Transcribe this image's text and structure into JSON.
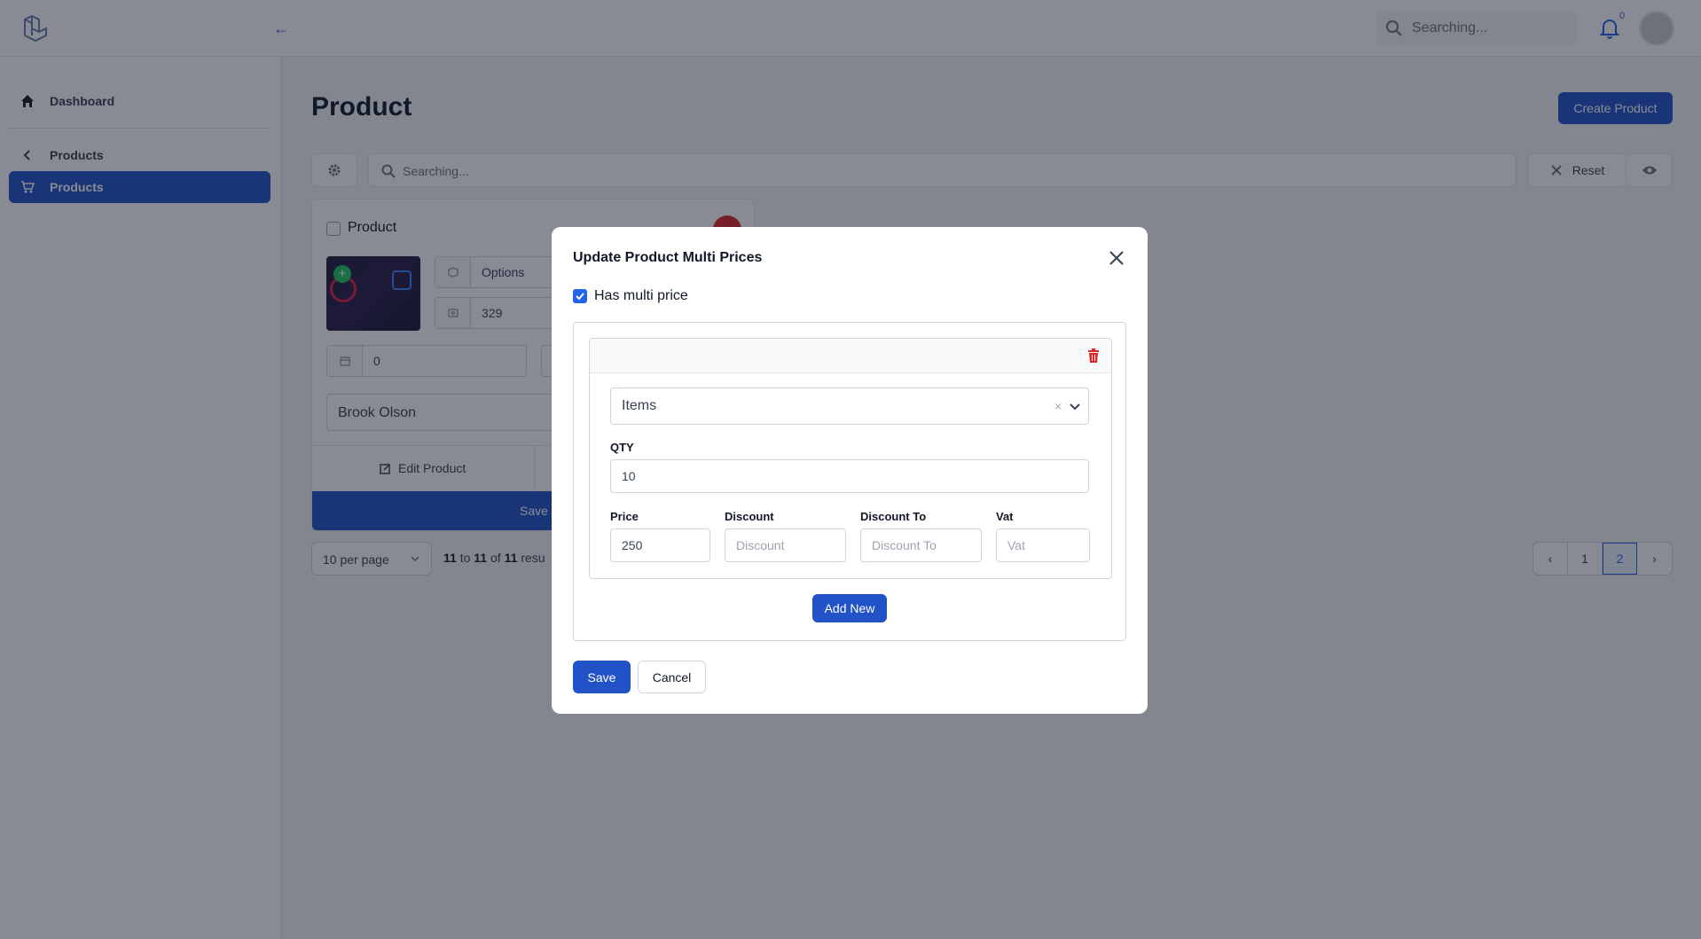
{
  "header": {
    "search_placeholder": "Searching...",
    "notification_count": "0"
  },
  "sidebar": {
    "items": [
      {
        "label": "Dashboard",
        "icon": "home-icon"
      },
      {
        "label": "Products",
        "icon": "chevron-left-icon"
      },
      {
        "label": "Products",
        "icon": "cart-icon",
        "active": true
      }
    ]
  },
  "main": {
    "title": "Product",
    "create_button": "Create Product",
    "search_placeholder": "Searching...",
    "reset_label": "Reset",
    "card": {
      "checkbox_label": "Product",
      "options_value": "Options",
      "price_value": "329",
      "qty_value": "0",
      "seller_value": "Brook Olson",
      "edit_label": "Edit Product",
      "save_label": "Save"
    },
    "per_page": "10 per page",
    "results": {
      "from": "11",
      "to_word": "to",
      "to": "11",
      "of_word": "of",
      "total": "11",
      "tail": "resu"
    },
    "pagination": {
      "prev": "‹",
      "pages": [
        "1",
        "2"
      ],
      "current": "2",
      "next": "›"
    }
  },
  "modal": {
    "title": "Update Product Multi Prices",
    "has_multi_price_label": "Has multi price",
    "has_multi_price_checked": true,
    "select_value": "Items",
    "select_clear": "×",
    "qty_label": "QTY",
    "qty_value": "10",
    "price_label": "Price",
    "price_value": "250",
    "discount_label": "Discount",
    "discount_placeholder": "Discount",
    "discount_to_label": "Discount To",
    "discount_to_placeholder": "Discount To",
    "vat_label": "Vat",
    "vat_placeholder": "Vat",
    "add_new_label": "Add New",
    "save_label": "Save",
    "cancel_label": "Cancel"
  },
  "colors": {
    "primary": "#2152c7",
    "danger": "#dc2626",
    "overlay": "rgba(17,24,39,0.5)"
  }
}
